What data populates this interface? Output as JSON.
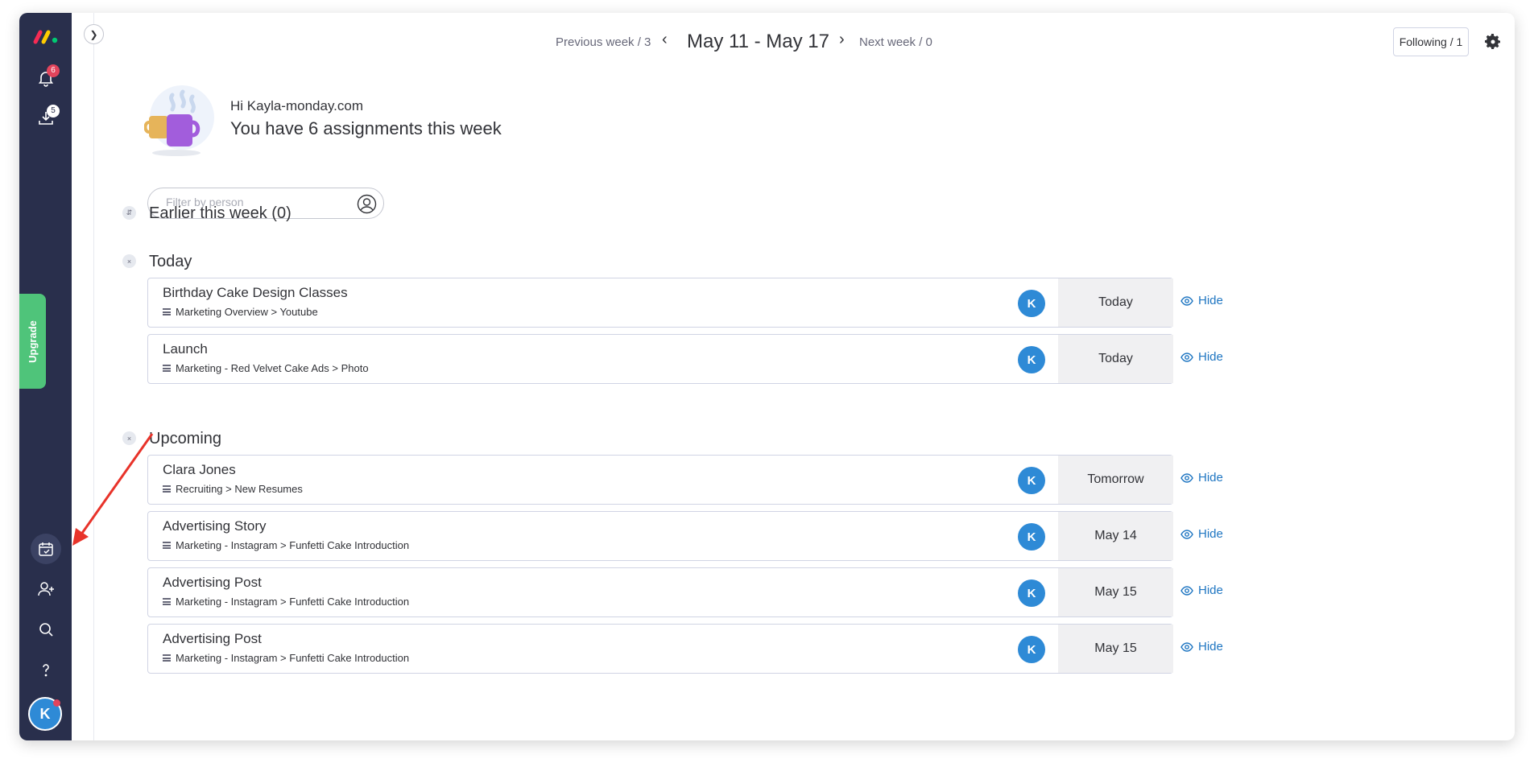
{
  "sidebar": {
    "notifications_badge": "6",
    "inbox_badge": "5",
    "upgrade_label": "Upgrade",
    "avatar_initial": "K"
  },
  "week_nav": {
    "previous": "Previous week / 3",
    "range": "May 11 - May 17",
    "next": "Next week / 0",
    "following": "Following / 1"
  },
  "greeting": {
    "hi": "Hi Kayla-monday.com",
    "summary": "You have 6 assignments this week"
  },
  "filter": {
    "placeholder": "Filter by person"
  },
  "sections": {
    "earlier": {
      "title": "Earlier this week",
      "count": "(0)"
    },
    "today": {
      "title": "Today"
    },
    "upcoming": {
      "title": "Upcoming"
    }
  },
  "items": [
    {
      "name": "Birthday Cake Design Classes",
      "sub": "Marketing Overview > Youtube",
      "avatar": "K",
      "date": "Today",
      "hide": "Hide"
    },
    {
      "name": "Launch",
      "sub": "Marketing - Red Velvet Cake Ads > Photo",
      "avatar": "K",
      "date": "Today",
      "hide": "Hide"
    },
    {
      "name": "Clara Jones",
      "sub": "Recruiting > New Resumes",
      "avatar": "K",
      "date": "Tomorrow",
      "hide": "Hide"
    },
    {
      "name": "Advertising Story",
      "sub": "Marketing - Instagram > Funfetti Cake Introduction",
      "avatar": "K",
      "date": "May 14",
      "hide": "Hide"
    },
    {
      "name": "Advertising Post",
      "sub": "Marketing - Instagram > Funfetti Cake Introduction",
      "avatar": "K",
      "date": "May 15",
      "hide": "Hide"
    },
    {
      "name": "Advertising Post",
      "sub": "Marketing - Instagram > Funfetti Cake Introduction",
      "avatar": "K",
      "date": "May 15",
      "hide": "Hide"
    }
  ],
  "colors": {
    "sidebar": "#292f4c",
    "upgrade": "#4fc47a",
    "avatar": "#2e8ad6",
    "link": "#1f76c2",
    "badge": "#e2445c",
    "annotation_arrow": "#e8332a"
  }
}
